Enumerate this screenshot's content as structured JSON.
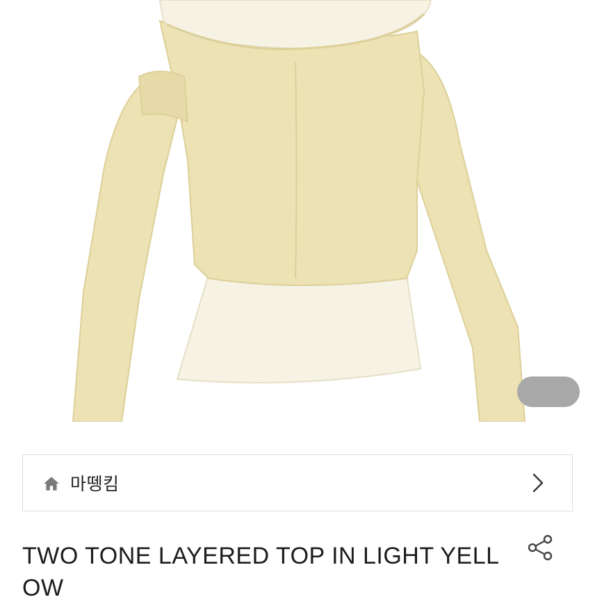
{
  "product_image": {
    "alt_icon": "product-photo",
    "colors": {
      "knit": "#ece2b4",
      "knit_shadow": "#dccf98",
      "sheer": "#f6f2e4",
      "background": "#ffffff"
    }
  },
  "gallery": {
    "pager_color": "#a8a8a8"
  },
  "shop": {
    "icon": "home-icon",
    "name": "마뗑킴",
    "chevron": "chevron-right-icon"
  },
  "product": {
    "title": "TWO TONE LAYERED TOP IN LIGHT YELLOW",
    "share_icon": "share-icon"
  }
}
